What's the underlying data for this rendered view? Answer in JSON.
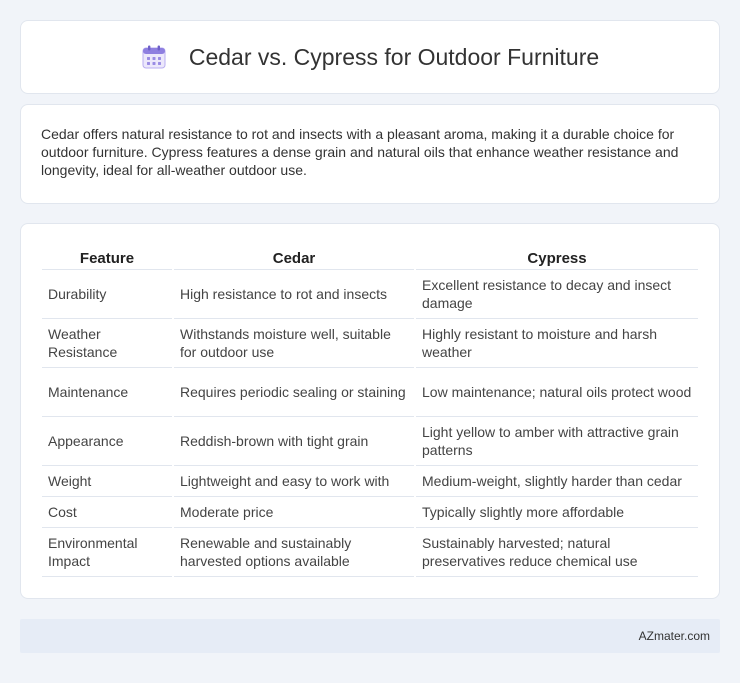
{
  "header": {
    "title": "Cedar vs. Cypress for Outdoor Furniture",
    "icon": "calendar-icon"
  },
  "summary": {
    "text": "Cedar offers natural resistance to rot and insects with a pleasant aroma, making it a durable choice for outdoor furniture. Cypress features a dense grain and natural oils that enhance weather resistance and longevity, ideal for all-weather outdoor use."
  },
  "table": {
    "headers": [
      "Feature",
      "Cedar",
      "Cypress"
    ],
    "rows": [
      [
        "Durability",
        "High resistance to rot and insects",
        "Excellent resistance to decay and insect damage"
      ],
      [
        "Weather Resistance",
        "Withstands moisture well, suitable for outdoor use",
        "Highly resistant to moisture and harsh weather"
      ],
      [
        "Maintenance",
        "Requires periodic sealing or staining",
        "Low maintenance; natural oils protect wood"
      ],
      [
        "Appearance",
        "Reddish-brown with tight grain",
        "Light yellow to amber with attractive grain patterns"
      ],
      [
        "Weight",
        "Lightweight and easy to work with",
        "Medium-weight, slightly harder than cedar"
      ],
      [
        "Cost",
        "Moderate price",
        "Typically slightly more affordable"
      ],
      [
        "Environmental Impact",
        "Renewable and sustainably harvested options available",
        "Sustainably harvested; natural preservatives reduce chemical use"
      ]
    ]
  },
  "footer": {
    "brand": "AZmater.com"
  },
  "colors": {
    "accent": "#7c6fd6",
    "background": "#f1f4f9",
    "footer": "#e6ecf6"
  }
}
